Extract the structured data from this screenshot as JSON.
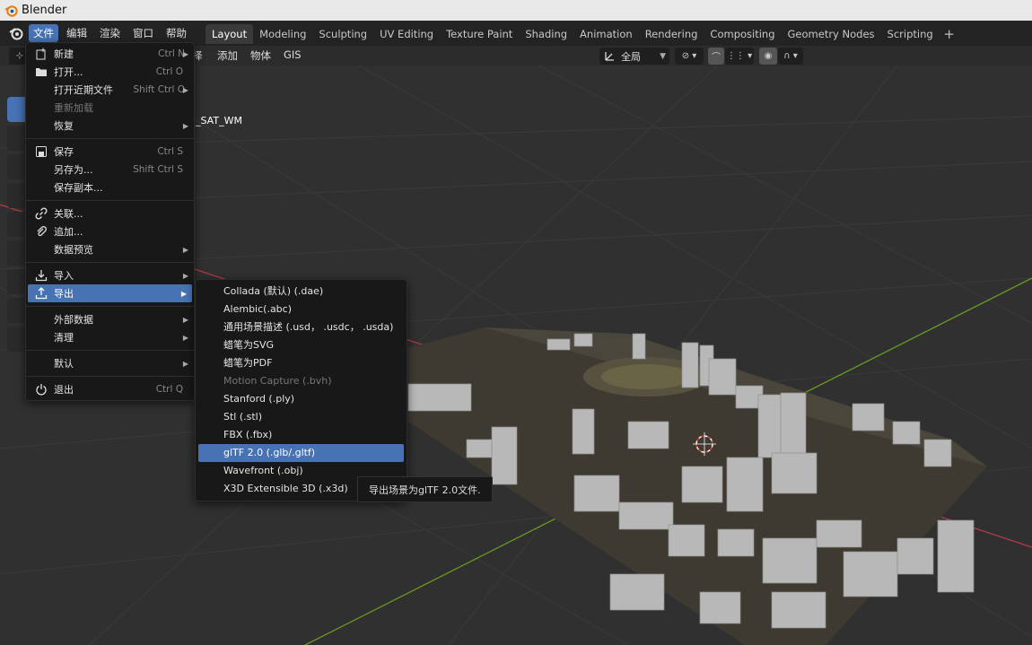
{
  "window": {
    "title": "Blender"
  },
  "topbar": {
    "menus": [
      "文件",
      "编辑",
      "渲染",
      "窗口",
      "帮助"
    ],
    "active_menu": 0,
    "workspaces": [
      "Layout",
      "Modeling",
      "Sculpting",
      "UV Editing",
      "Texture Paint",
      "Shading",
      "Animation",
      "Rendering",
      "Compositing",
      "Geometry Nodes",
      "Scripting"
    ],
    "active_workspace": 0,
    "add_workspace": "+"
  },
  "viewport_header": {
    "menus": [
      "择",
      "添加",
      "物体",
      "GIS"
    ],
    "orientation": "全局",
    "object_label": "_SAT_WM"
  },
  "file_menu": {
    "items": [
      {
        "icon": "new-file-icon",
        "label": "新建",
        "shortcut": "Ctrl N",
        "submenu": true
      },
      {
        "icon": "folder-icon",
        "label": "打开...",
        "shortcut": "Ctrl O"
      },
      {
        "label": "打开近期文件",
        "shortcut": "Shift Ctrl O",
        "submenu": true
      },
      {
        "label": "重新加载",
        "disabled": true
      },
      {
        "label": "恢复",
        "submenu": true
      },
      {
        "separator": true
      },
      {
        "icon": "save-icon",
        "label": "保存",
        "shortcut": "Ctrl S"
      },
      {
        "label": "另存为...",
        "shortcut": "Shift Ctrl S"
      },
      {
        "label": "保存副本..."
      },
      {
        "separator": true
      },
      {
        "icon": "link-icon",
        "label": "关联..."
      },
      {
        "icon": "append-icon",
        "label": "追加..."
      },
      {
        "label": "数据预览",
        "submenu": true
      },
      {
        "separator": true
      },
      {
        "icon": "import-icon",
        "label": "导入",
        "submenu": true
      },
      {
        "icon": "export-icon",
        "label": "导出",
        "submenu": true,
        "highlighted": true
      },
      {
        "separator": true
      },
      {
        "label": "外部数据",
        "submenu": true
      },
      {
        "label": "清理",
        "submenu": true
      },
      {
        "separator": true
      },
      {
        "label": "默认",
        "submenu": true
      },
      {
        "separator": true
      },
      {
        "icon": "quit-icon",
        "label": "退出",
        "shortcut": "Ctrl Q"
      }
    ]
  },
  "export_menu": {
    "items": [
      {
        "label": "Collada (默认) (.dae)"
      },
      {
        "label": "Alembic(.abc)"
      },
      {
        "label": "通用场景描述 (.usd， .usdc， .usda)"
      },
      {
        "label": "蜡笔为SVG"
      },
      {
        "label": "蜡笔为PDF"
      },
      {
        "label": "Motion Capture (.bvh)",
        "disabled": true
      },
      {
        "label": "Stanford (.ply)"
      },
      {
        "label": "Stl (.stl)"
      },
      {
        "label": "FBX (.fbx)"
      },
      {
        "label": "glTF 2.0 (.glb/.gltf)",
        "highlighted": true
      },
      {
        "label": "Wavefront (.obj)"
      },
      {
        "label": "X3D Extensible 3D (.x3d)"
      }
    ]
  },
  "tooltip": {
    "text": "导出场景为glTF 2.0文件."
  },
  "colors": {
    "accent": "#4772b3",
    "x_axis": "#b13b44",
    "y_axis": "#6a9a23",
    "background": "#303030"
  }
}
